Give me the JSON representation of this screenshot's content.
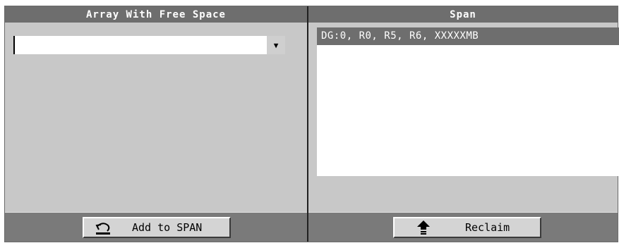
{
  "left_panel": {
    "title": "Array With Free Space",
    "dropdown": {
      "value": "",
      "arrow": "▼"
    },
    "add_button": {
      "label": "Add to SPAN",
      "icon": "undo-arrow-icon"
    }
  },
  "right_panel": {
    "title": "Span",
    "items": [
      {
        "label": "DG:0, R0, R5, R6, XXXXXMB",
        "selected": true
      }
    ],
    "reclaim_button": {
      "label": "Reclaim",
      "icon": "up-arrow-icon"
    }
  },
  "colors": {
    "header": "#6e6e6e",
    "panel": "#c8c8c8",
    "footer": "#7a7a7a",
    "selection": "#6e6e6e"
  }
}
